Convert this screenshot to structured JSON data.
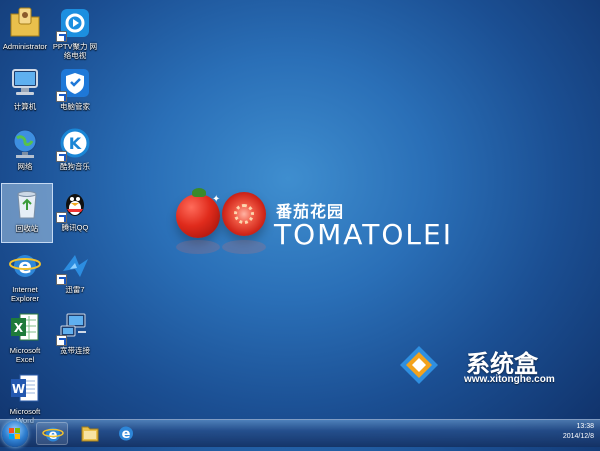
{
  "desktop": {
    "icons": [
      {
        "id": "administrator",
        "label": "Administrator"
      },
      {
        "id": "pptv",
        "label": "PPTV聚力 网络电视"
      },
      {
        "id": "computer",
        "label": "计算机"
      },
      {
        "id": "pc-manager",
        "label": "电脑管家"
      },
      {
        "id": "network",
        "label": "网络"
      },
      {
        "id": "kuwo",
        "label": "酷狗音乐"
      },
      {
        "id": "recycle-bin",
        "label": "回收站"
      },
      {
        "id": "qq",
        "label": "腾讯QQ"
      },
      {
        "id": "ie",
        "label": "Internet Explorer"
      },
      {
        "id": "xunlei",
        "label": "迅雷7"
      },
      {
        "id": "excel",
        "label": "Microsoft Excel"
      },
      {
        "id": "broadband",
        "label": "宽带连接"
      },
      {
        "id": "word",
        "label": "Microsoft Word"
      }
    ]
  },
  "brand": {
    "cn": "番茄花园",
    "en": "TOMATOLEI"
  },
  "watermark": {
    "cn": "系统盒",
    "url": "www.xitonghe.com"
  },
  "taskbar": {
    "clock_time": "13:38",
    "clock_date": "2014/12/8"
  },
  "colors": {
    "bg_center": "#3f8ecf",
    "bg_edge": "#0f2f66",
    "tomato": "#e02b1c"
  }
}
